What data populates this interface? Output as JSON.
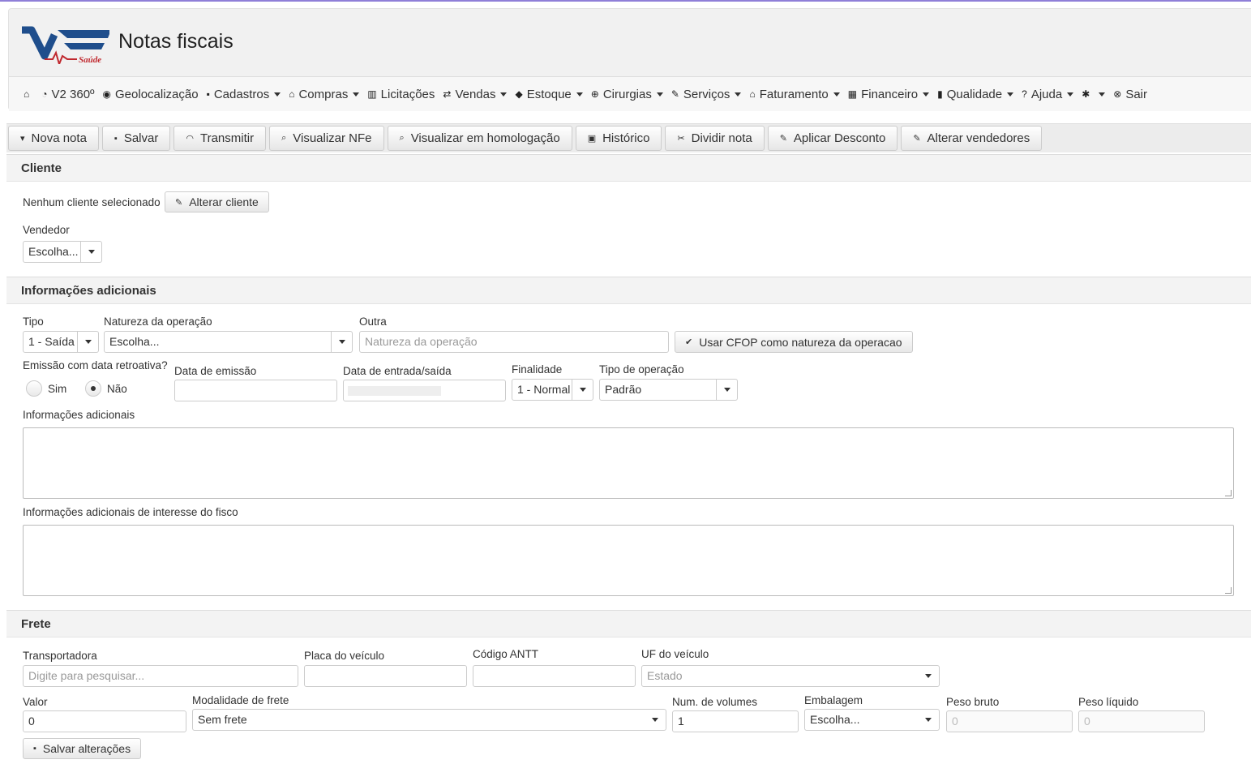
{
  "app": {
    "logo_text": "V2",
    "logo_sub": "Saúde",
    "title": "Notas fiscais"
  },
  "nav": [
    {
      "icon": "home-icon",
      "label": ""
    },
    {
      "icon": "pie-chart-icon",
      "label": "V2 360º"
    },
    {
      "icon": "globe-icon",
      "label": "Geolocalização"
    },
    {
      "icon": "save-icon",
      "label": "Cadastros",
      "dropdown": true
    },
    {
      "icon": "bank-icon",
      "label": "Compras",
      "dropdown": true
    },
    {
      "icon": "building-icon",
      "label": "Licitações"
    },
    {
      "icon": "exchange-icon",
      "label": "Vendas",
      "dropdown": true
    },
    {
      "icon": "tag-icon",
      "label": "Estoque",
      "dropdown": true
    },
    {
      "icon": "plus-circle-icon",
      "label": "Cirurgias",
      "dropdown": true
    },
    {
      "icon": "wrench-icon",
      "label": "Serviços",
      "dropdown": true
    },
    {
      "icon": "bank-icon",
      "label": "Faturamento",
      "dropdown": true
    },
    {
      "icon": "calculator-icon",
      "label": "Financeiro",
      "dropdown": true
    },
    {
      "icon": "book-icon",
      "label": "Qualidade",
      "dropdown": true
    },
    {
      "icon": "question-icon",
      "label": "Ajuda",
      "dropdown": true
    },
    {
      "icon": "gear-icon",
      "label": "",
      "dropdown": true
    },
    {
      "icon": "close-circle-icon",
      "label": "Sair"
    }
  ],
  "toolbar": [
    {
      "name": "nova-nota-button",
      "icon": "caret-down-icon",
      "label": "Nova nota"
    },
    {
      "name": "salvar-button",
      "icon": "save-icon",
      "label": "Salvar"
    },
    {
      "name": "transmitir-button",
      "icon": "rss-icon",
      "label": "Transmitir"
    },
    {
      "name": "visualizar-nfe-button",
      "icon": "search-icon",
      "label": "Visualizar NFe"
    },
    {
      "name": "visualizar-homologacao-button",
      "icon": "search-icon",
      "label": "Visualizar em homologação"
    },
    {
      "name": "historico-button",
      "icon": "calendar-icon",
      "label": "Histórico"
    },
    {
      "name": "dividir-nota-button",
      "icon": "scissors-icon",
      "label": "Dividir nota"
    },
    {
      "name": "aplicar-desconto-button",
      "icon": "pencil-icon",
      "label": "Aplicar Desconto"
    },
    {
      "name": "alterar-vendedores-button",
      "icon": "pencil-icon",
      "label": "Alterar vendedores"
    }
  ],
  "cliente": {
    "heading": "Cliente",
    "none_text": "Nenhum cliente selecionado",
    "alter_button": "Alterar cliente",
    "vendedor_label": "Vendedor",
    "vendedor_value": "Escolha..."
  },
  "info": {
    "heading": "Informações adicionais",
    "tipo_label": "Tipo",
    "tipo_value": "1 - Saída",
    "natureza_label": "Natureza da operação",
    "natureza_value": "Escolha...",
    "outra_label": "Outra",
    "outra_placeholder": "Natureza da operação",
    "cfop_button": "Usar CFOP como natureza da operacao",
    "retro_label": "Emissão com data retroativa?",
    "sim_label": "Sim",
    "nao_label": "Não",
    "emissao_label": "Data de emissão",
    "entrada_label": "Data de entrada/saída",
    "finalidade_label": "Finalidade",
    "finalidade_value": "1 - Normal",
    "tipo_op_label": "Tipo de operação",
    "tipo_op_value": "Padrão",
    "adicionais_label": "Informações adicionais",
    "fisco_label": "Informações adicionais de interesse do fisco"
  },
  "frete": {
    "heading": "Frete",
    "transportadora_label": "Transportadora",
    "transportadora_placeholder": "Digite para pesquisar...",
    "placa_label": "Placa do veículo",
    "antt_label": "Código ANTT",
    "uf_label": "UF do veículo",
    "uf_placeholder": "Estado",
    "valor_label": "Valor",
    "valor_value": "0",
    "modalidade_label": "Modalidade de frete",
    "modalidade_value": "Sem frete",
    "volumes_label": "Num. de volumes",
    "volumes_value": "1",
    "embalagem_label": "Embalagem",
    "embalagem_value": "Escolha...",
    "peso_bruto_label": "Peso bruto",
    "peso_bruto_placeholder": "0",
    "peso_liquido_label": "Peso líquido",
    "peso_liquido_placeholder": "0",
    "salvar_button": "Salvar alterações"
  }
}
